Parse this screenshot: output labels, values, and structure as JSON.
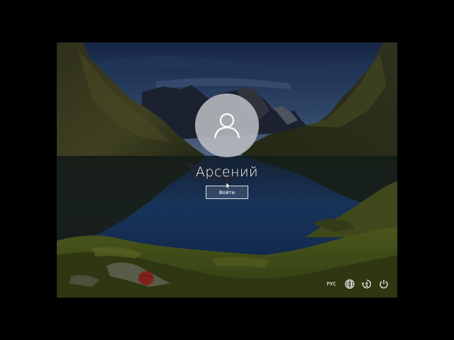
{
  "lock_screen": {
    "username": "Арсений",
    "signin_label": "Войти"
  },
  "tray": {
    "language": "РУС",
    "icons": [
      "globe-icon",
      "ease-of-access-icon",
      "power-icon"
    ]
  },
  "colors": {
    "text": "#ffffff",
    "avatar_bg": "#b9bcc2",
    "background": "#000000"
  }
}
